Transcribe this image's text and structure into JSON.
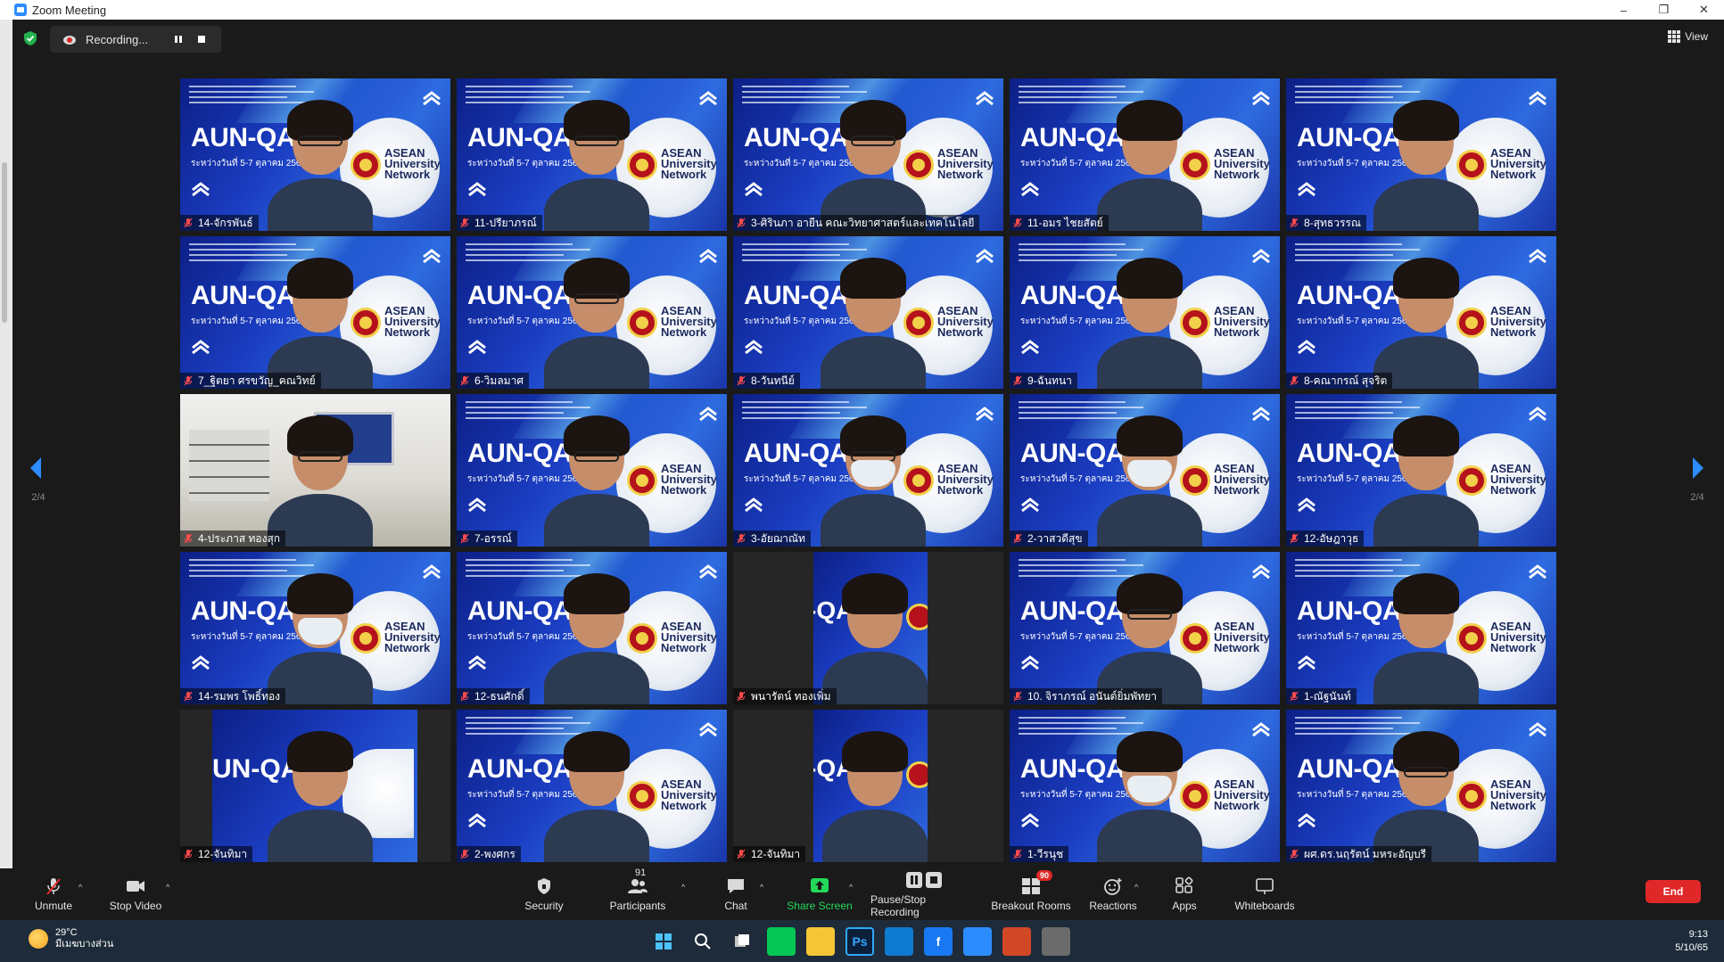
{
  "window": {
    "title": "Zoom Meeting",
    "controls": [
      "–",
      "❐",
      "✕"
    ]
  },
  "meeting_header": {
    "recording_label": "Recording...",
    "pause_icon": "pause-icon",
    "stop_icon": "stop-icon",
    "view_label": "View"
  },
  "pagination": {
    "left_page": "2/4",
    "right_page": "2/4"
  },
  "colors": {
    "accent_blue": "#2d8cff",
    "end_red": "#e02828",
    "share_green": "#23d959",
    "background": "#1a1a1a"
  },
  "tiles": [
    {
      "name": "14-จักรพันธ์",
      "style": "aun-mirror",
      "glasses": true,
      "mask": false
    },
    {
      "name": "11-ปรียาภรณ์",
      "style": "aun",
      "glasses": true,
      "mask": false
    },
    {
      "name": "3-ศิรินภา อายืน คณะวิทยาศาสตร์และเทคโนโลยี",
      "style": "aun",
      "glasses": true,
      "mask": false
    },
    {
      "name": "11-อมร ไชยสัตย์",
      "style": "aun",
      "glasses": false,
      "mask": false
    },
    {
      "name": "8-สุทธวรรณ",
      "style": "aun",
      "glasses": false,
      "mask": false
    },
    {
      "name": "7_ฐิตยา ศรขวัญ_คณวิทย์",
      "style": "aun",
      "glasses": false,
      "mask": false
    },
    {
      "name": "6-วิมลมาศ",
      "style": "aun",
      "glasses": true,
      "mask": false
    },
    {
      "name": "8-วันทนีย์",
      "style": "aun",
      "glasses": false,
      "mask": false
    },
    {
      "name": "9-ฉันทนา",
      "style": "aun",
      "glasses": false,
      "mask": false
    },
    {
      "name": "8-คณากรณ์ สุจริต",
      "style": "aun",
      "glasses": false,
      "mask": false
    },
    {
      "name": "4-ประภาส ทองสุก",
      "style": "office",
      "glasses": true,
      "mask": false
    },
    {
      "name": "7-อรรณ์",
      "style": "aun",
      "glasses": true,
      "mask": false
    },
    {
      "name": "3-อัยฌาณัท",
      "style": "aun",
      "glasses": true,
      "mask": true
    },
    {
      "name": "2-วาสวดีสุข",
      "style": "aun",
      "glasses": false,
      "mask": true
    },
    {
      "name": "12-อัษฎาวุธ",
      "style": "aun",
      "glasses": false,
      "mask": false
    },
    {
      "name": "14-รมพร โพธิ์ทอง",
      "style": "aun",
      "glasses": false,
      "mask": true
    },
    {
      "name": "12-ธนศักดิ์",
      "style": "aun",
      "glasses": false,
      "mask": false
    },
    {
      "name": "พนารัตน์ ทองเพิ่ม",
      "style": "dark",
      "glasses": false,
      "mask": false
    },
    {
      "name": "10. จิราภรณ์ อนันต์ยิ่มพัทยา",
      "style": "aun",
      "glasses": true,
      "mask": false
    },
    {
      "name": "1-ณัฐนันท์",
      "style": "aun",
      "glasses": false,
      "mask": false
    },
    {
      "name": "12-จันทิมา",
      "style": "wide-dark",
      "glasses": false,
      "mask": false
    },
    {
      "name": "2-พงศกร",
      "style": "aun",
      "glasses": false,
      "mask": false
    },
    {
      "name": "12-จันทิมา",
      "style": "dark",
      "glasses": false,
      "mask": false
    },
    {
      "name": "1-วีรนุช",
      "style": "aun",
      "glasses": false,
      "mask": true
    },
    {
      "name": "ผศ.ดร.นฤรัตน์ มหระอัญบรี",
      "style": "aun",
      "glasses": true,
      "mask": false
    }
  ],
  "tile_text": {
    "aun": "AUN-QA",
    "aun_mirror": "AUN-QA",
    "thai_sub": "ระหว่างวันที่ 5-7 ตุลาคม 2565",
    "asean_line1": "ASEAN",
    "asean_line2": "University",
    "asean_line3": "Network",
    "qa_crop": "-QA",
    "un_qa_crop": "UN-QA"
  },
  "toolbar": {
    "unmute": "Unmute",
    "stop_video": "Stop Video",
    "security": "Security",
    "participants": "Participants",
    "participants_count": "91",
    "chat": "Chat",
    "share_screen": "Share Screen",
    "pause_stop_recording": "Pause/Stop Recording",
    "breakout_rooms": "Breakout Rooms",
    "breakout_badge": "90",
    "reactions": "Reactions",
    "apps": "Apps",
    "whiteboards": "Whiteboards",
    "end": "End"
  },
  "taskbar": {
    "temperature": "29°C",
    "weather_desc": "มีเมฆบางส่วน",
    "time": "9:13",
    "date": "5/10/65",
    "apps": [
      "windows-icon",
      "search-icon",
      "task-view-icon",
      "line-icon",
      "file-explorer-icon",
      "photoshop-icon",
      "edge-icon",
      "facebook-icon",
      "zoom-icon",
      "powerpoint-icon",
      "app-icon"
    ],
    "app_labels": [
      "",
      "",
      "",
      "",
      "",
      "Ps",
      "",
      "f",
      "",
      "",
      ""
    ]
  }
}
